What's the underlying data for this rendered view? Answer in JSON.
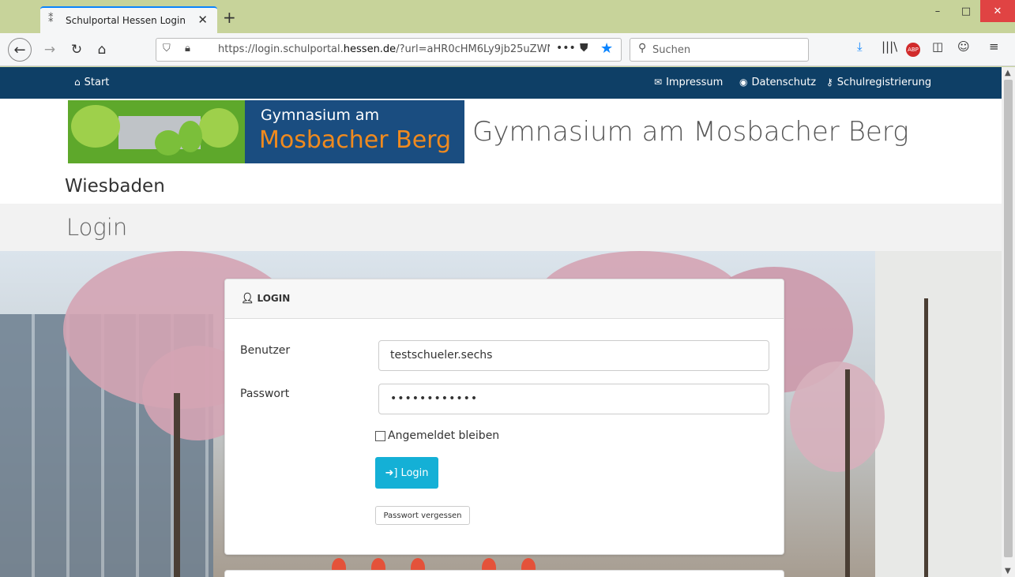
{
  "browser": {
    "tab_title": "Schulportal Hessen Login",
    "tab_close": "✕",
    "new_tab": "+",
    "url_prefix": "https://login.schulportal.",
    "url_host": "hessen.de",
    "url_suffix": "/?url=aHR0cHM6Ly9jb25uZWN0",
    "search_placeholder": "Suchen",
    "window_minimize": "–",
    "window_maximize": "□",
    "window_close": "✕"
  },
  "site_nav": {
    "start": "Start",
    "impressum": "Impressum",
    "datenschutz": "Datenschutz",
    "schulregistrierung": "Schulregistrierung"
  },
  "logo": {
    "line1": "Gymnasium am",
    "line2": "Mosbacher Berg"
  },
  "header": {
    "school_name": "Gymnasium am Mosbacher Berg",
    "city": "Wiesbaden",
    "page_title": "Login"
  },
  "login_card": {
    "heading": "LOGIN",
    "user_label": "Benutzer",
    "user_value": "testschueler.sechs",
    "password_label": "Passwort",
    "password_value": "••••••••••••",
    "remember_label": "Angemeldet bleiben",
    "remember_checked": false,
    "login_button": "Login",
    "forgot_button": "Passwort vergessen"
  },
  "colors": {
    "nav_bg": "#0e3f66",
    "login_button": "#14b0d6",
    "logo_accent": "#f08a1e"
  }
}
